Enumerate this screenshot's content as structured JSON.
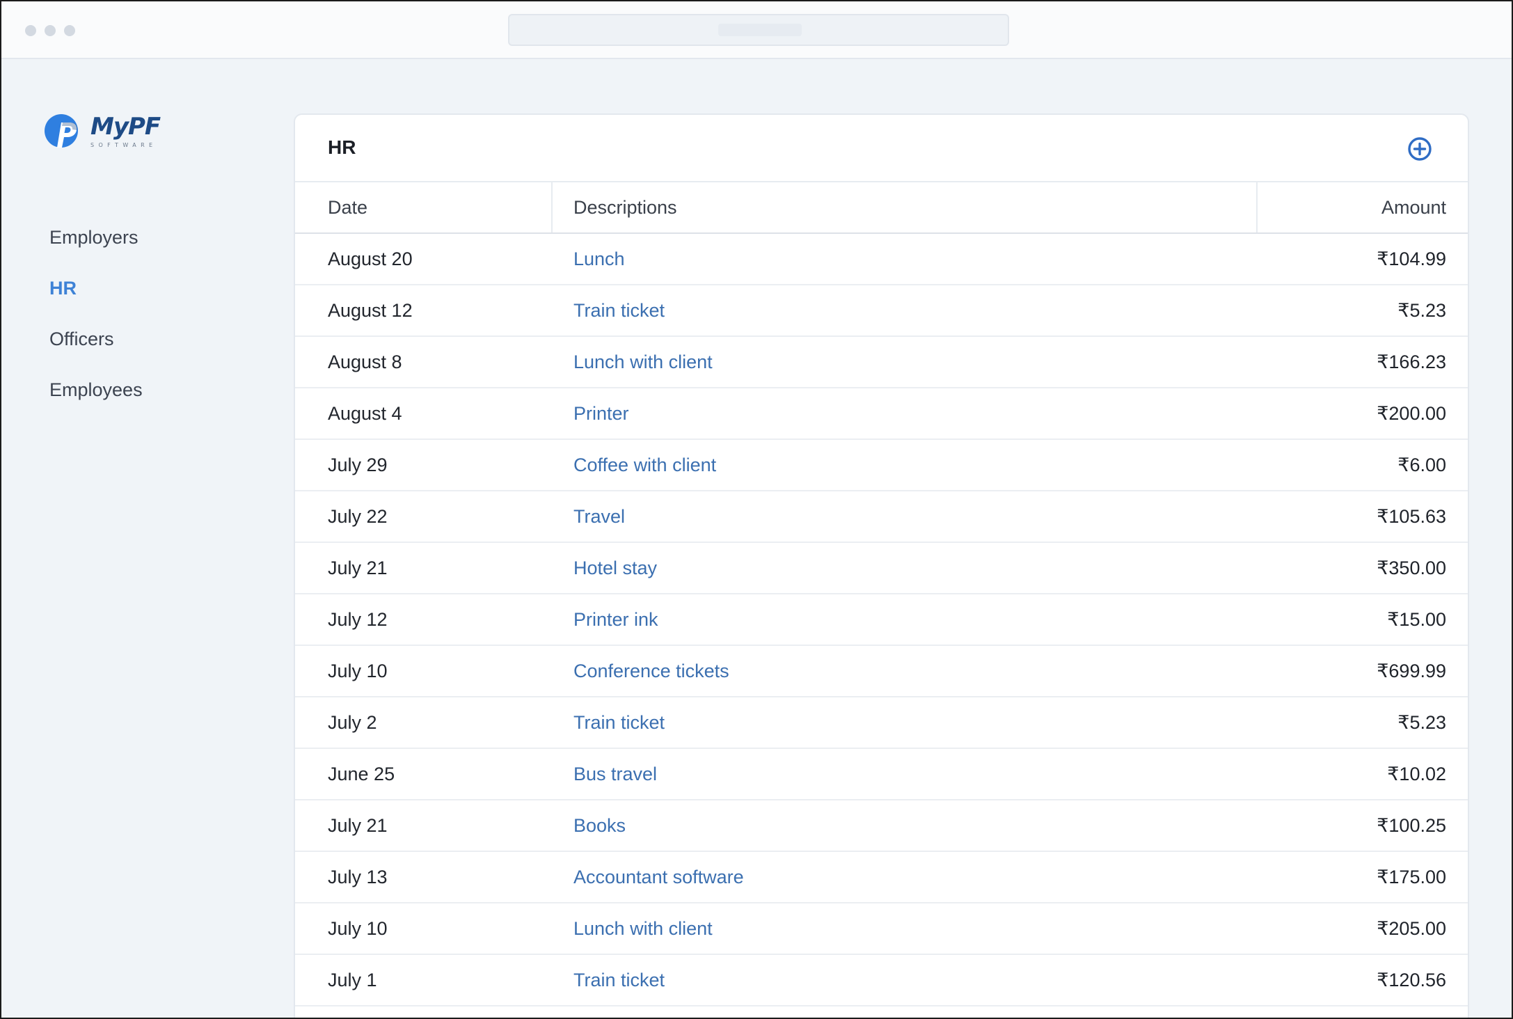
{
  "brand": {
    "name": "MyPF",
    "tagline": "SOFTWARE",
    "color": "#1e4b86",
    "accent": "#2f7fe0"
  },
  "sidebar": {
    "items": [
      {
        "label": "Employers",
        "active": false
      },
      {
        "label": "HR",
        "active": true
      },
      {
        "label": "Officers",
        "active": false
      },
      {
        "label": "Employees",
        "active": false
      }
    ]
  },
  "card": {
    "title": "HR",
    "add_icon": "plus-circle-icon"
  },
  "table": {
    "headers": {
      "date": "Date",
      "description": "Descriptions",
      "amount": "Amount"
    },
    "rows": [
      {
        "date": "August 20",
        "description": "Lunch",
        "amount": "₹104.99"
      },
      {
        "date": "August 12",
        "description": "Train ticket",
        "amount": "₹5.23"
      },
      {
        "date": "August 8",
        "description": "Lunch with client",
        "amount": "₹166.23"
      },
      {
        "date": "August 4",
        "description": "Printer",
        "amount": "₹200.00"
      },
      {
        "date": "July 29",
        "description": "Coffee with client",
        "amount": "₹6.00"
      },
      {
        "date": "July 22",
        "description": "Travel",
        "amount": "₹105.63"
      },
      {
        "date": "July 21",
        "description": "Hotel stay",
        "amount": "₹350.00"
      },
      {
        "date": "July 12",
        "description": "Printer ink",
        "amount": "₹15.00"
      },
      {
        "date": "July 10",
        "description": "Conference tickets",
        "amount": "₹699.99"
      },
      {
        "date": "July 2",
        "description": "Train ticket",
        "amount": "₹5.23"
      },
      {
        "date": "June 25",
        "description": "Bus travel",
        "amount": "₹10.02"
      },
      {
        "date": "July 21",
        "description": "Books",
        "amount": "₹100.25"
      },
      {
        "date": "July 13",
        "description": "Accountant software",
        "amount": "₹175.00"
      },
      {
        "date": "July 10",
        "description": "Lunch with client",
        "amount": "₹205.00"
      },
      {
        "date": "July 1",
        "description": "Train ticket",
        "amount": "₹120.56"
      }
    ]
  }
}
